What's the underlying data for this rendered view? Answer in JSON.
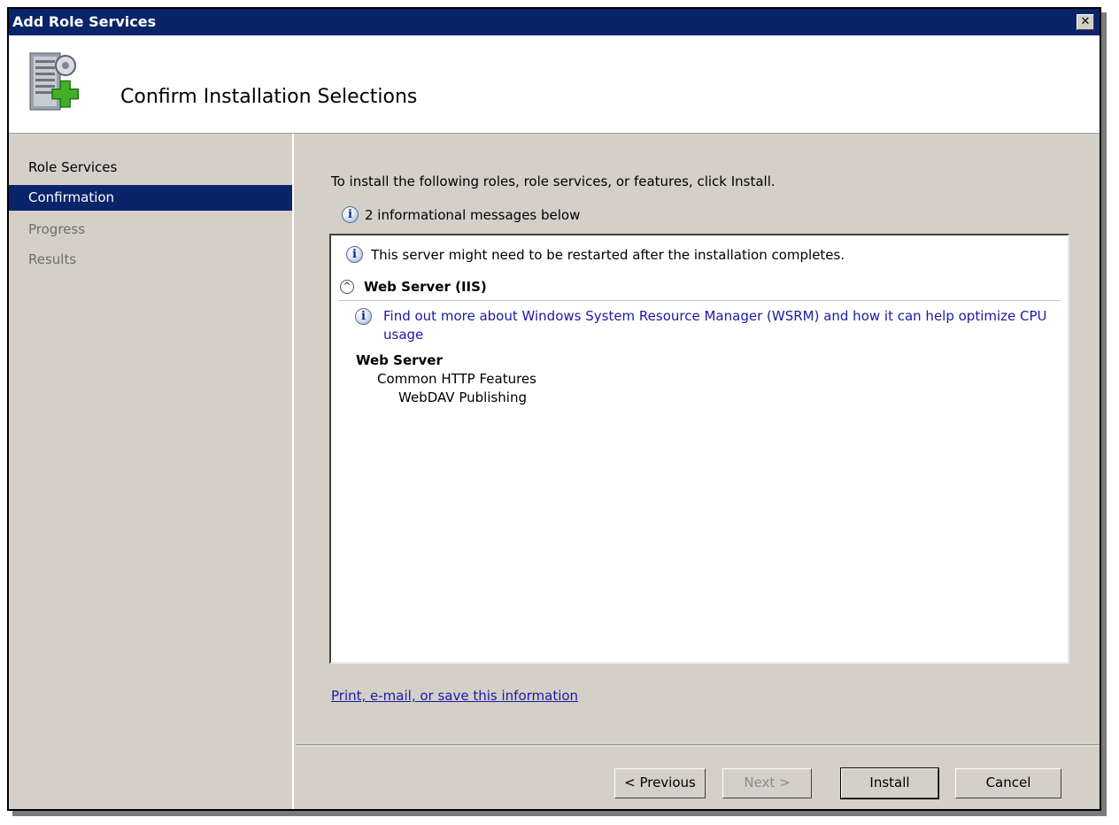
{
  "window": {
    "title": "Add Role Services",
    "close_glyph": "✕"
  },
  "header": {
    "title": "Confirm Installation Selections",
    "icon": "server-add-icon"
  },
  "nav": {
    "items": [
      {
        "label": "Role Services",
        "state": "done"
      },
      {
        "label": "Confirmation",
        "state": "active"
      },
      {
        "label": "Progress",
        "state": "pending"
      },
      {
        "label": "Results",
        "state": "pending"
      }
    ]
  },
  "content": {
    "intro": "To install the following roles, role services, or features, click Install.",
    "message_count": "2 informational messages below",
    "restart_notice": "This server might need to be restarted after the installation completes.",
    "section_title": "Web Server (IIS)",
    "wsrm_link_line1": "Find out more about Windows System Resource Manager (WSRM) and how it can help optimize CPU",
    "wsrm_link_line2": "usage",
    "tree": {
      "level1": "Web Server",
      "level2": "Common HTTP Features",
      "level3": "WebDAV Publishing"
    },
    "print_link": "Print, e-mail, or save this information"
  },
  "buttons": {
    "previous": "< Previous",
    "next": "Next >",
    "install": "Install",
    "cancel": "Cancel"
  },
  "icons": {
    "info": "i",
    "collapse": "^"
  },
  "colors": {
    "title_bar": "#0a246a",
    "selected_nav": "#0a246a",
    "link": "#1a1aa6",
    "dialog_face": "#d4d0c8"
  }
}
